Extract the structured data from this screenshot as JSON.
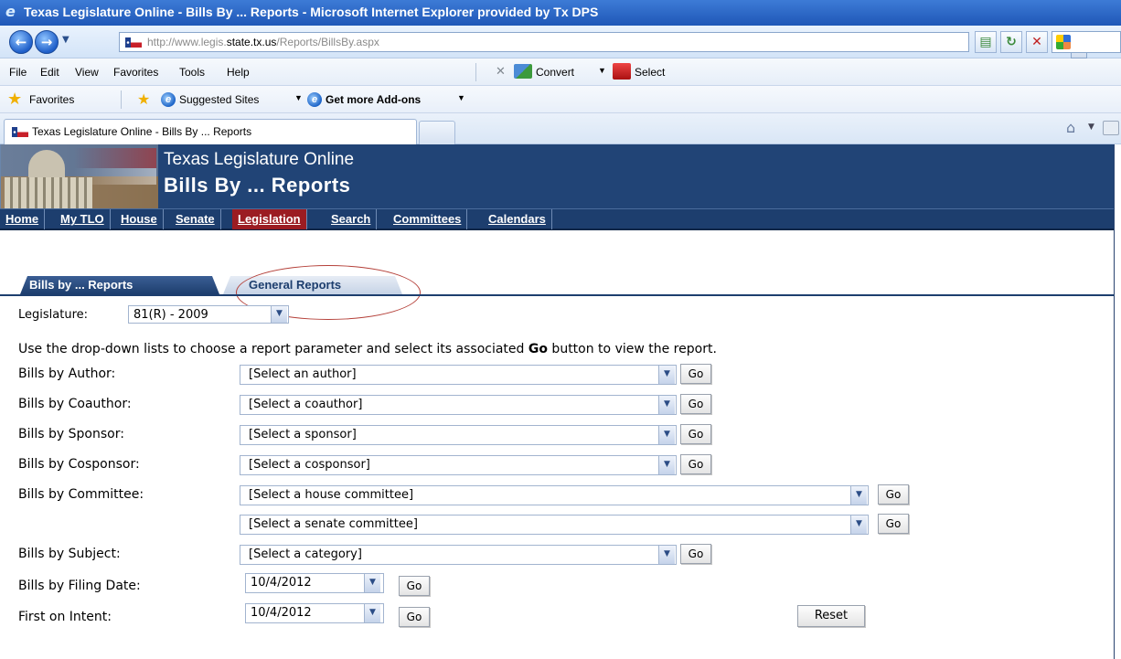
{
  "window": {
    "title": "Texas Legislature Online - Bills By ... Reports - Microsoft Internet Explorer provided by Tx DPS"
  },
  "address": {
    "prefix": "http://www.legis.",
    "domain": "state.tx.us",
    "path": "/Reports/BillsBy.aspx"
  },
  "menu": {
    "items": [
      "File",
      "Edit",
      "View",
      "Favorites",
      "Tools",
      "Help"
    ],
    "convert_label": "Convert",
    "select_label": "Select"
  },
  "favorites_bar": {
    "favorites_label": "Favorites",
    "suggested_sites_label": "Suggested Sites",
    "addons_label": "Get more Add-ons"
  },
  "tab": {
    "label": "Texas Legislature Online - Bills By ... Reports"
  },
  "banner": {
    "title": "Texas Legislature Online",
    "subtitle": "Bills By ... Reports"
  },
  "nav": {
    "items": [
      "Home",
      "My TLO",
      "House",
      "Senate",
      "Legislation",
      "Search",
      "Committees",
      "Calendars"
    ],
    "active": "Legislation"
  },
  "subtabs": {
    "active_label": "Bills by ... Reports",
    "general_label": "General Reports"
  },
  "legislature": {
    "label": "Legislature:",
    "value": "81(R) - 2009"
  },
  "instructions": {
    "pre": "Use the drop-down lists to choose a report parameter and select its associated ",
    "bold": "Go",
    "post": " button to view the report."
  },
  "form": {
    "author": {
      "label": "Bills by Author:",
      "placeholder": "[Select an author]"
    },
    "coauthor": {
      "label": "Bills by Coauthor:",
      "placeholder": "[Select a coauthor]"
    },
    "sponsor": {
      "label": "Bills by Sponsor:",
      "placeholder": "[Select a sponsor]"
    },
    "cosponsor": {
      "label": "Bills by Cosponsor:",
      "placeholder": "[Select a cosponsor]"
    },
    "committee": {
      "label": "Bills by Committee:",
      "house_placeholder": "[Select a house committee]",
      "senate_placeholder": "[Select a senate committee]"
    },
    "subject": {
      "label": "Bills by Subject:",
      "placeholder": "[Select a category]"
    },
    "filing_date": {
      "label": "Bills by Filing Date:",
      "value": "10/4/2012"
    },
    "first_on_intent": {
      "label": "First on Intent:",
      "value": "10/4/2012"
    },
    "go_label": "Go",
    "reset_label": "Reset"
  },
  "colors": {
    "header_navy": "#214476",
    "nav_navy": "#1d3e6e",
    "nav_active": "#9b1c22",
    "highlight_ellipse": "#b5413a"
  }
}
